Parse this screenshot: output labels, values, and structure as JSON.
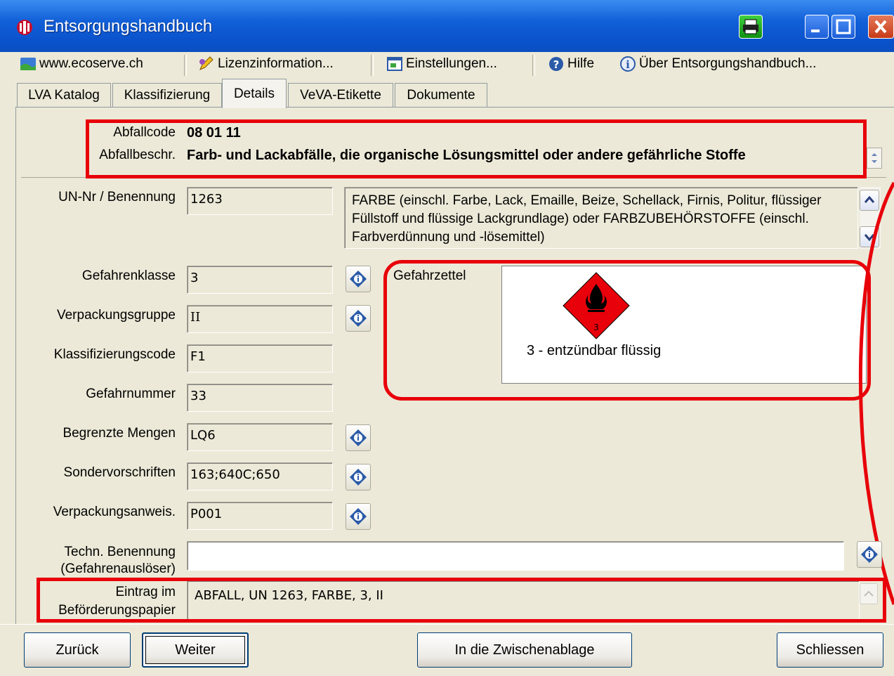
{
  "window": {
    "title": "Entsorgungshandbuch"
  },
  "toolbar": {
    "website": "www.ecoserve.ch",
    "license": "Lizenzinformation...",
    "settings": "Einstellungen...",
    "help": "Hilfe",
    "about": "Über Entsorgungshandbuch..."
  },
  "tabs": [
    {
      "label": "LVA Katalog"
    },
    {
      "label": "Klassifizierung"
    },
    {
      "label": "Details"
    },
    {
      "label": "VeVA-Etikette"
    },
    {
      "label": "Dokumente"
    }
  ],
  "header": {
    "code_label": "Abfallcode",
    "code_value": "08 01 11",
    "desc_label": "Abfallbeschr.",
    "desc_value": "Farb- und Lackabfälle, die organische Lösungsmittel oder andere gefährliche Stoffe"
  },
  "un": {
    "label": "UN-Nr / Benennung",
    "number": "1263",
    "description": "FARBE (einschl. Farbe, Lack, Emaille, Beize, Schellack, Firnis, Politur, flüssiger Füllstoff und flüssige Lackgrundlage) oder FARBZUBEHÖRSTOFFE (einschl. Farbverdünnung und -lösemittel)"
  },
  "fields": {
    "gefahrenklasse": {
      "label": "Gefahrenklasse",
      "value": "3"
    },
    "verpackungsgruppe": {
      "label": "Verpackungsgruppe",
      "value": "II"
    },
    "klassifizierungscode": {
      "label": "Klassifizierungscode",
      "value": "F1"
    },
    "gefahrnummer": {
      "label": "Gefahrnummer",
      "value": "33"
    },
    "begrenzte_mengen": {
      "label": "Begrenzte Mengen",
      "value": "LQ6"
    },
    "sondervorschriften": {
      "label": "Sondervorschriften",
      "value": "163;640C;650"
    },
    "verpackungsanweis": {
      "label": "Verpackungsanweis.",
      "value": "P001"
    }
  },
  "hazard": {
    "label": "Gefahrzettel",
    "caption": "3 - entzündbar flüssig",
    "diamond_number": "3",
    "diamond_color": "#e8000a"
  },
  "techn": {
    "label_line1": "Techn. Benennung",
    "label_line2": "(Gefahrenauslöser)",
    "value": ""
  },
  "entry": {
    "label_line1": "Eintrag im",
    "label_line2": "Beförderungspapier",
    "value": "ABFALL, UN 1263, FARBE, 3, II"
  },
  "buttons": {
    "back": "Zurück",
    "next": "Weiter",
    "clipboard": "In die Zwischenablage",
    "close": "Schliessen"
  },
  "colors": {
    "highlight": "#e8000a",
    "titlebar": "#0a52cc"
  }
}
